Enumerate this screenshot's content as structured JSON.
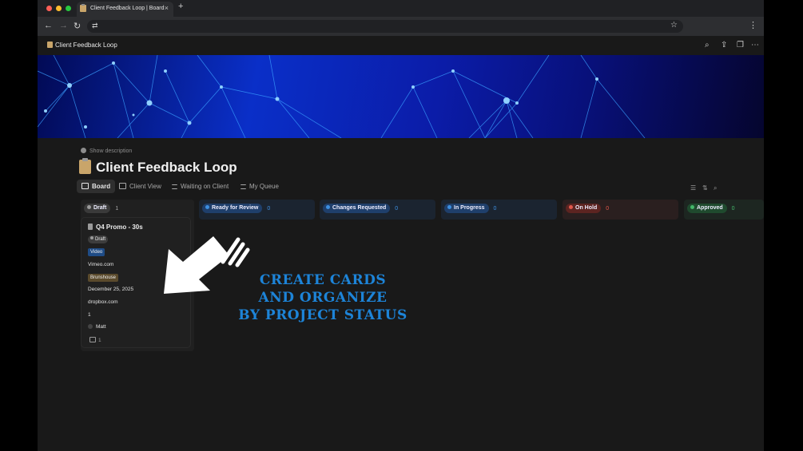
{
  "browser": {
    "tab_title": "Client Feedback Loop | Board",
    "tab_close": "×",
    "new_tab": "+",
    "back": "←",
    "forward": "→",
    "reload": "↻",
    "url_tune_icon": "⇄",
    "bookmark_icon": "☆",
    "menu_icon": "⋮"
  },
  "notion_top": {
    "page_name": "Client Feedback Loop",
    "icons": [
      "search-icon",
      "share-icon",
      "duplicate-icon",
      "more-icon"
    ],
    "search": "⌕",
    "share": "⇪",
    "duplicate": "❐",
    "more": "⋯"
  },
  "page": {
    "show_description": "Show description",
    "title": "Client Feedback Loop"
  },
  "views": [
    {
      "label": "Board",
      "active": true
    },
    {
      "label": "Client View",
      "active": false
    },
    {
      "label": "Waiting on Client",
      "active": false
    },
    {
      "label": "My Queue",
      "active": false
    }
  ],
  "view_tools": {
    "filter": "☰",
    "sort": "⇅",
    "search": "⌕"
  },
  "columns": [
    {
      "label": "Draft",
      "count": "1",
      "pill_bg": "#3a3a3a",
      "dot": "#9b9b9b",
      "col_bg": "#202020",
      "count_color": "#a8a8a8"
    },
    {
      "label": "Ready for Review",
      "count": "0",
      "pill_bg": "#1f3f6b",
      "dot": "#3d8fe0",
      "col_bg": "#1b2430",
      "count_color": "#3d8fe0"
    },
    {
      "label": "Changes Requested",
      "count": "0",
      "pill_bg": "#1f3f6b",
      "dot": "#3d8fe0",
      "col_bg": "#1b2430",
      "count_color": "#3d8fe0"
    },
    {
      "label": "In Progress",
      "count": "0",
      "pill_bg": "#1f3f6b",
      "dot": "#3d8fe0",
      "col_bg": "#1b2430",
      "count_color": "#3d8fe0"
    },
    {
      "label": "On Hold",
      "count": "0",
      "pill_bg": "#5c2421",
      "dot": "#e0574b",
      "col_bg": "#2a1f1f",
      "count_color": "#e0574b"
    },
    {
      "label": "Approved",
      "count": "0",
      "pill_bg": "#1f4a2e",
      "dot": "#44b86a",
      "col_bg": "#1d2621",
      "count_color": "#44b86a"
    }
  ],
  "card": {
    "title": "Q4 Promo - 30s",
    "status": "Draft",
    "type": "Video",
    "platform": "Vimeo.com",
    "client": "Brunshouse",
    "date": "December 25, 2025",
    "link": "dropbox.com",
    "number": "1",
    "assignee": "Matt",
    "comments": "1"
  },
  "overlay": {
    "line1": "CREATE CARDS",
    "line2": "AND ORGANIZE",
    "line3": "BY PROJECT STATUS",
    "color": "#1d84d8"
  }
}
